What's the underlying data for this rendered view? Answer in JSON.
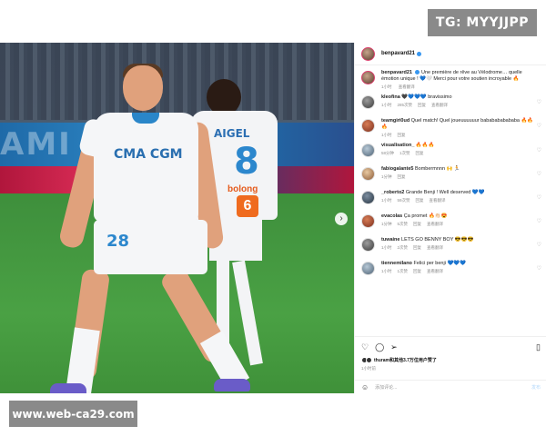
{
  "watermarks": {
    "top": "TG: MYYJJPP",
    "bottom": "www.web-ca29.com"
  },
  "photo": {
    "banner_text": "AMI",
    "player_back_name": "AIGEL",
    "player_back_number": "8",
    "player_back_sponsor": "bolong",
    "player_back_badge": "6",
    "player_front_sponsor": "CMA CGM",
    "player_front_number": "28"
  },
  "post": {
    "username": "benpavard21",
    "caption_user": "benpavard21",
    "caption_text": "Une première de rêve au Vélodrome… quelle émotion unique ! 💙🤍 Merci pour votre soutien incroyable 🔥",
    "caption_time": "1小时",
    "caption_translate": "查看翻译"
  },
  "comments": [
    {
      "user": "kleofina",
      "text": "🖤💙💙💙 bravissimo",
      "time": "1小时",
      "likes": "285次赞",
      "reply": "回复",
      "translate": "查看翻译"
    },
    {
      "user": "teamgiri0ud",
      "text": "Quel match! Quel joueuuuuuur bababababababa 🔥🔥🔥",
      "time": "1小时",
      "likes": "",
      "reply": "回复",
      "translate": ""
    },
    {
      "user": "visualisation_",
      "text": "🔥🔥🔥",
      "time": "58分钟",
      "likes": "1次赞",
      "reply": "回复",
      "translate": ""
    },
    {
      "user": "fabiogalante5",
      "text": "Bombermnnn 🙌 🏃",
      "time": "1分钟",
      "likes": "",
      "reply": "回复",
      "translate": ""
    },
    {
      "user": "_roberto2",
      "text": "Grande Benji ! Well deserved 💙💙",
      "time": "1小时",
      "likes": "59次赞",
      "reply": "回复",
      "translate": "查看翻译"
    },
    {
      "user": "evacolas",
      "text": "Ça promet 🔥👏🏻😍",
      "time": "1分钟",
      "likes": "5次赞",
      "reply": "回复",
      "translate": "查看翻译"
    },
    {
      "user": "tuwaine",
      "text": "LETS GO BENNY BOY 😎😎😎",
      "time": "1小时",
      "likes": "2次赞",
      "reply": "回复",
      "translate": "查看翻译"
    },
    {
      "user": "tiennemilano",
      "text": "Felici per benji 💙💙💙",
      "time": "1小时",
      "likes": "1次赞",
      "reply": "回复",
      "translate": "查看翻译"
    }
  ],
  "actions": {
    "likes_text": "thuram和其他3.7万位用户赞了",
    "post_date": "1小时前"
  },
  "add_comment": {
    "placeholder": "添加评论...",
    "post_label": "发布"
  }
}
